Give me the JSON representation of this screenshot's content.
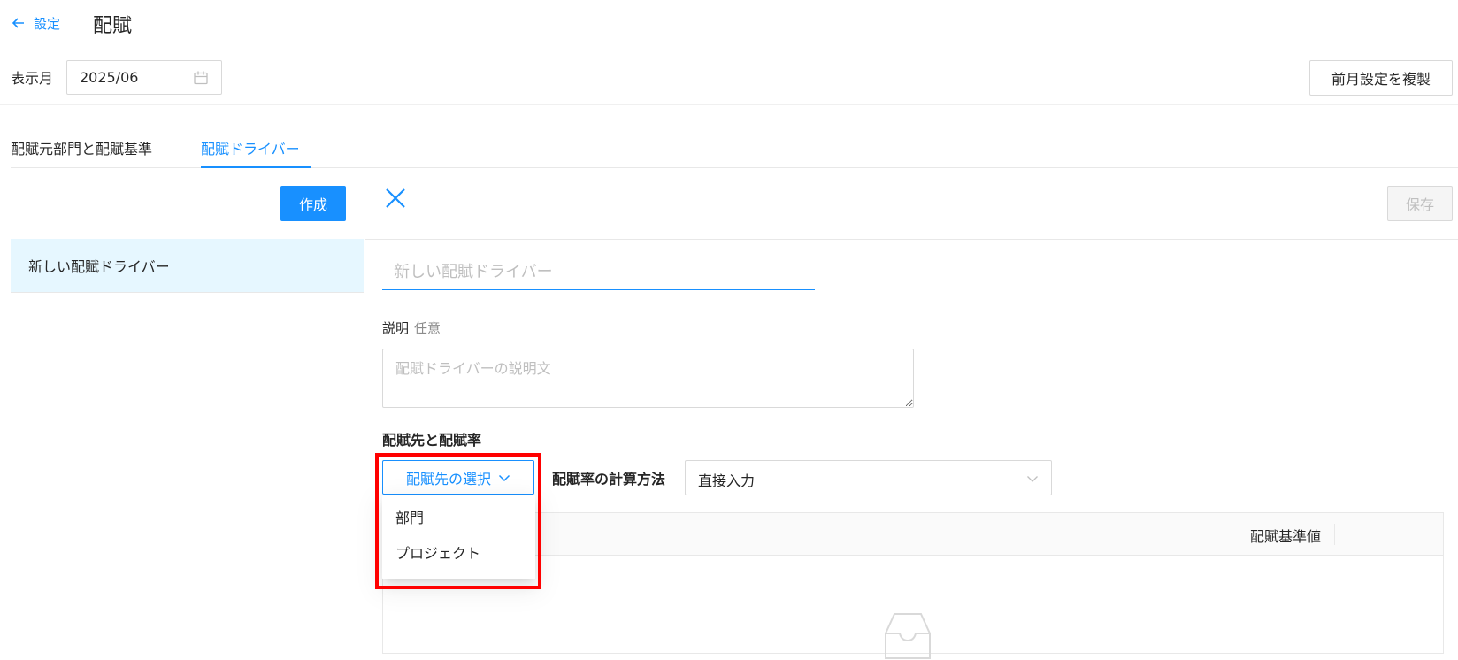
{
  "header": {
    "back_label": "設定",
    "title": "配賦"
  },
  "toolbar": {
    "month_label": "表示月",
    "month_value": "2025/06",
    "copy_button": "前月設定を複製"
  },
  "tabs": [
    {
      "label": "配賦元部門と配賦基準",
      "active": false
    },
    {
      "label": "配賦ドライバー",
      "active": true
    }
  ],
  "sidebar": {
    "create_button": "作成",
    "items": [
      {
        "label": "新しい配賦ドライバー",
        "selected": true
      }
    ]
  },
  "editor": {
    "save_button": "保存",
    "name_placeholder": "新しい配賦ドライバー",
    "description_label": "説明",
    "description_optional": "任意",
    "description_placeholder": "配賦ドライバーの説明文",
    "section_title": "配賦先と配賦率",
    "target_select_label": "配賦先の選択",
    "calc_label": "配賦率の計算方法",
    "calc_value": "直接入力",
    "table_header_value": "配賦基準値"
  },
  "dropdown": {
    "options": [
      "部門",
      "プロジェクト"
    ]
  },
  "colors": {
    "accent": "#1890ff",
    "selected_bg": "#e6f7ff",
    "highlight": "#ff0000"
  }
}
